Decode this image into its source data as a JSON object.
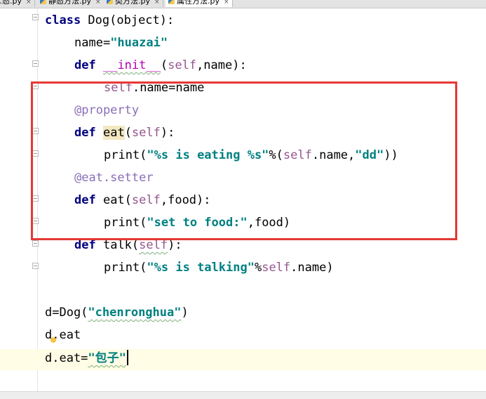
{
  "tabs": [
    {
      "label": "…态.py",
      "active": false
    },
    {
      "label": "静态方法.py",
      "active": false
    },
    {
      "label": "类方法.py",
      "active": false
    },
    {
      "label": "属性方法.py",
      "active": true
    }
  ],
  "tab_close_glyph": "×",
  "code": {
    "l1": {
      "kw": "class",
      "rest": " Dog(object):"
    },
    "l2": {
      "a": "name=",
      "s": "\"huazai\""
    },
    "l3": {
      "kw": "def",
      "sp": " ",
      "magic": "__init__",
      "p1": "(",
      "self": "self",
      "p2": ",name):"
    },
    "l4": {
      "self": "self",
      "rest": ".name=name"
    },
    "l5": {
      "deco": "@property"
    },
    "l6": {
      "kw": "def",
      "sp": " ",
      "name": "eat",
      "p1": "(",
      "self": "self",
      "p2": "):"
    },
    "l7": {
      "a": "print(",
      "s1": "\"%s is eating %s\"",
      "b": "%(",
      "self": "self",
      "c": ".name,",
      "s2": "\"dd\"",
      "d": "))"
    },
    "l8": {
      "deco": "@eat.setter"
    },
    "l9": {
      "kw": "def",
      "a": " eat(",
      "self": "self",
      "b": ",food):"
    },
    "l10": {
      "a": "print(",
      "s": "\"set to food:\"",
      "b": ",food)"
    },
    "l11": {
      "kw": "def",
      "a": " talk(",
      "self": "self",
      "b": "):"
    },
    "l12": {
      "a": "print(",
      "s": "\"%s is talking\"",
      "b": "%",
      "self": "self",
      "c": ".name)"
    },
    "l13": {
      "a": "d=Dog(",
      "s": "\"chenronghua\"",
      "b": ")"
    },
    "l14": {
      "a": "d",
      "b": ".eat"
    },
    "l15": {
      "a": "d.eat=",
      "s": "\"包子\""
    }
  },
  "colors": {
    "keyword": "#000080",
    "string": "#008080",
    "self": "#94558d",
    "decorator": "#8a6eb7",
    "highlight_box": "#e53935",
    "caret_line": "#fffde6"
  }
}
